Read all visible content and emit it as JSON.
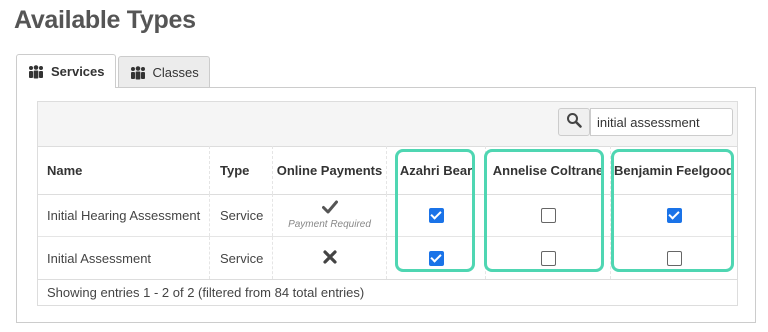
{
  "page": {
    "title": "Available Types"
  },
  "tabs": [
    {
      "label": "Services",
      "icon": "people-group-icon",
      "active": true
    },
    {
      "label": "Classes",
      "icon": "people-group-icon",
      "active": false
    }
  ],
  "search": {
    "icon": "search-icon",
    "value": "initial assessment"
  },
  "table": {
    "columns": [
      "Name",
      "Type",
      "Online Payments",
      "Azahri Bear",
      "Annelise Coltrane",
      "Benjamin Feelgood"
    ],
    "rows": [
      {
        "name": "Initial Hearing Assessment",
        "type": "Service",
        "online_payment_icon": "checkmark-icon",
        "online_payment_note": "Payment Required",
        "azahri_bear": true,
        "annelise_coltrane": false,
        "benjamin_feelgood": true
      },
      {
        "name": "Initial Assessment",
        "type": "Service",
        "online_payment_icon": "x-mark-icon",
        "online_payment_note": "",
        "azahri_bear": true,
        "annelise_coltrane": false,
        "benjamin_feelgood": false
      }
    ],
    "footer": "Showing entries 1 - 2 of 2 (filtered from 84 total entries)"
  },
  "colors": {
    "highlight": "#4fd6b2",
    "checkbox_checked": "#1a73e8"
  }
}
